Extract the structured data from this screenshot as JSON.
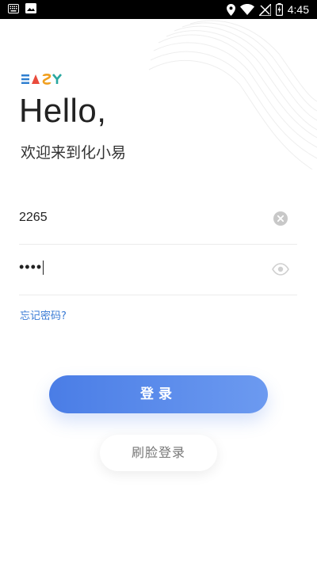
{
  "status_bar": {
    "time": "4:45",
    "icons": [
      "keyboard-icon",
      "image-icon",
      "location-icon",
      "wifi-icon",
      "signal-icon",
      "battery-icon"
    ]
  },
  "logo": {
    "text": "EASY",
    "colors": [
      "#2f7fd0",
      "#e94b3c",
      "#f0a020",
      "#29a8a0"
    ]
  },
  "greeting": "Hello,",
  "welcome": "欢迎来到化小易",
  "username_field": {
    "value": "2265",
    "clear_icon": "clear-icon"
  },
  "password_field": {
    "value": "••••",
    "toggle_icon": "eye-icon"
  },
  "forgot_password": "忘记密码?",
  "login_button": "登录",
  "face_login_button": "刷脸登录",
  "colors": {
    "accent": "#4a7de6",
    "link": "#3a7bd5"
  }
}
